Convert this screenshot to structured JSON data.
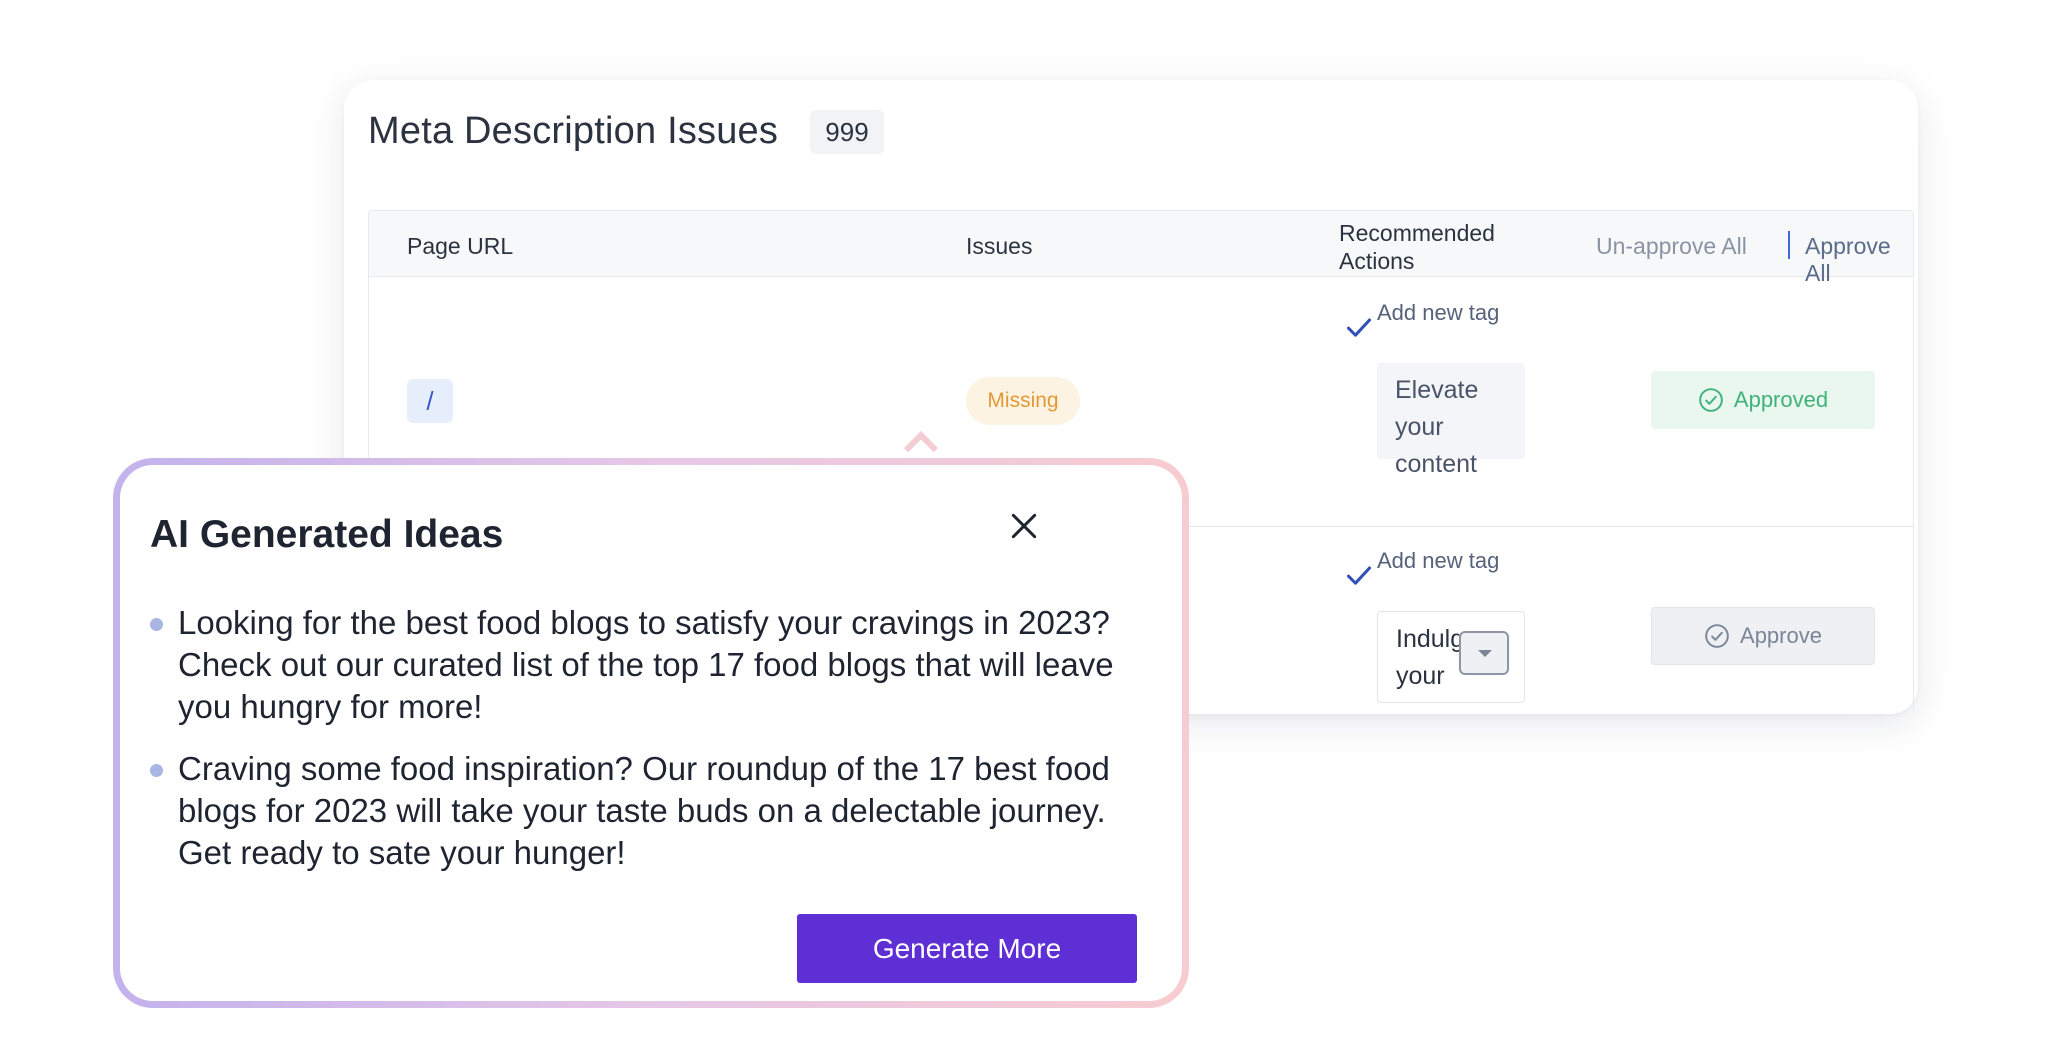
{
  "card": {
    "title": "Meta Description Issues",
    "count": "999"
  },
  "table": {
    "headers": {
      "page_url": "Page URL",
      "issues": "Issues",
      "recommended_actions": "Recommended Actions",
      "unapprove_all": "Un-approve All",
      "approve_all": "Approve All"
    },
    "rows": [
      {
        "url": "/",
        "issue": "Missing",
        "action_label": "Add new tag",
        "action_text": "Elevate your content",
        "status": "Approved"
      },
      {
        "action_label": "Add new tag",
        "action_text": "Indulge your",
        "status": "Approve"
      }
    ]
  },
  "popup": {
    "title": "AI Generated Ideas",
    "ideas": [
      "Looking for the best food blogs to satisfy your cravings in 2023? Check out our curated list of the top 17 food blogs that will leave you hungry for more!",
      "Craving some food inspiration? Our roundup of the 17 best food blogs for 2023 will take your taste buds on a delectable journey. Get ready to sate your hunger!"
    ],
    "generate_label": "Generate More"
  },
  "colors": {
    "accent": "#5f2fd6",
    "approved": "#3fb27a",
    "missing": "#e39a35",
    "check": "#2f4fb8"
  },
  "icons": {
    "check": "check-icon",
    "close": "close-icon",
    "approved": "check-circle-icon"
  }
}
